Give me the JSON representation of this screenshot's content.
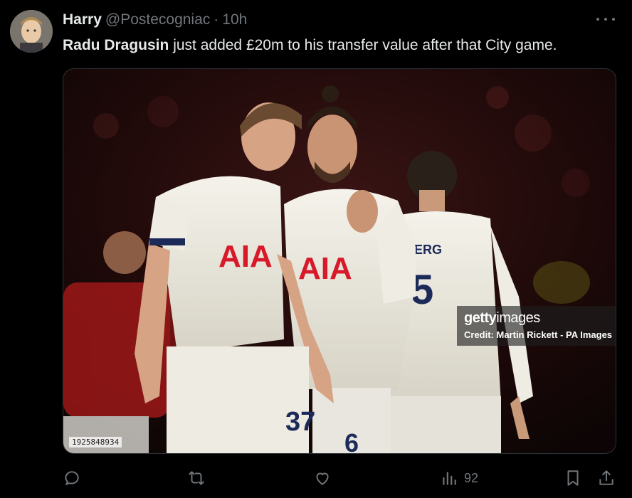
{
  "colors": {
    "background": "#000000",
    "text_primary": "#e7e9ea",
    "text_secondary": "#71767b"
  },
  "tweet": {
    "display_name": "Harry",
    "handle": "@Postecogniac",
    "separator": "·",
    "time": "10h",
    "text_bold": "Radu Dragusin",
    "text_rest": " just added £20m to his transfer value after that City game."
  },
  "media": {
    "watermark_logo_bold": "getty",
    "watermark_logo_thin": "images",
    "watermark_credit": "Credit: Martin Rickett - PA Images",
    "image_id": "1925848934",
    "shirt_sponsor": "AIA"
  },
  "actions": {
    "views_count": "92",
    "icons": [
      "reply-icon",
      "retweet-icon",
      "like-icon",
      "views-icon",
      "bookmark-icon",
      "share-icon"
    ]
  }
}
